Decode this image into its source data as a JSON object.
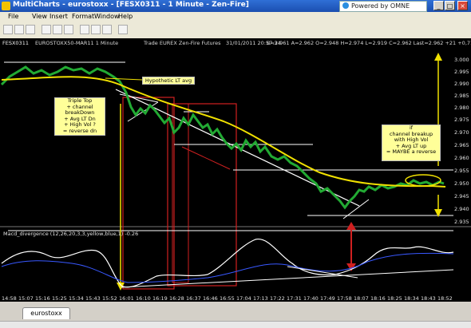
{
  "window": {
    "title": "MultiCharts - eurostoxx - [FESX0311 - 1 Minute - Zen-Fire]",
    "brand": "Powered by OMNE",
    "buttons": [
      "_",
      "□",
      "×"
    ]
  },
  "menu": [
    "File",
    "View",
    "Insert",
    "Format",
    "Window",
    "Help"
  ],
  "info_bar": {
    "symbol": "FESX0311",
    "description": "EUROSTOXX50-MAR11  1 Minute",
    "exchange": "Trade  EUREX  Zen-Fire Futures",
    "datetime": "31/01/2011  20:57.34",
    "quote": "B=2.961  A=2.962  O=2.948  H=2.974  L=2.919  C=2.962  Last=2.962  +21  +0,71%"
  },
  "price_axis": [
    "3.000",
    "2.995",
    "2.990",
    "2.985",
    "2.980",
    "2.975",
    "2.970",
    "2.965",
    "2.960",
    "2.955",
    "2.950",
    "2.945",
    "2.940",
    "2.935"
  ],
  "time_axis": [
    "14:58",
    "15:07",
    "15:16",
    "15:25",
    "15:34",
    "15:43",
    "15:52",
    "16:01",
    "16:10",
    "16:19",
    "16:28",
    "16:37",
    "16:46",
    "16:55",
    "17:04",
    "17:13",
    "17:22",
    "17:31",
    "17:40",
    "17:49",
    "17:58",
    "18:07",
    "18:16",
    "18:25",
    "18:34",
    "18:43",
    "18:52"
  ],
  "indicator_label": "Macd_divergence (12,26,20,3,3,yellow,blue,1)   -0.26",
  "annotations": {
    "hypothetic": "Hypothetic LT avg",
    "left_box": [
      "Triple Top",
      "+ channel breakDown",
      "+ Avg LT Dn",
      "+ High Vol ?",
      "= reverse dn"
    ],
    "right_box": [
      "if",
      "channel breakup",
      "with High Vol",
      "+ Avg LT up",
      "= MAYBE a reverse"
    ]
  },
  "tabs": [
    "eurostoxx"
  ],
  "colors": {
    "background": "#000000",
    "price": "#22aa33",
    "avg": "#f0e000",
    "lines": "#ffffff",
    "boxes": "#d02020"
  }
}
